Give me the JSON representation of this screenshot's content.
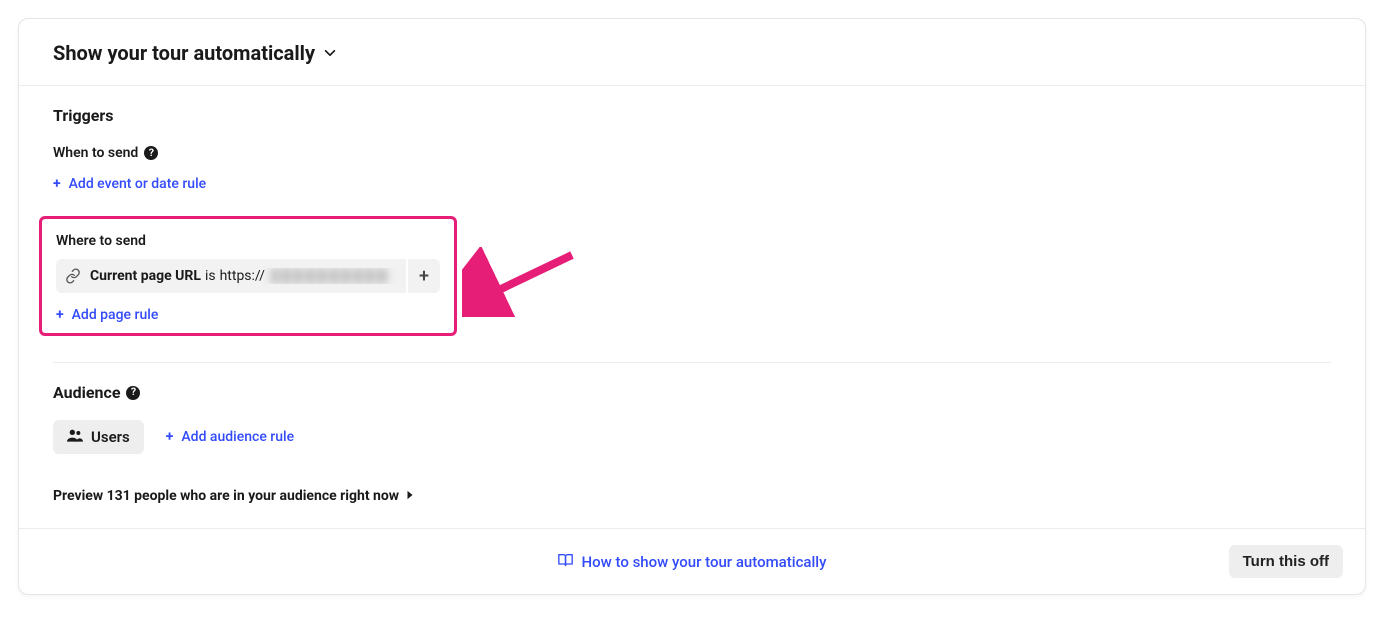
{
  "header": {
    "title": "Show your tour automatically"
  },
  "triggers": {
    "section_title": "Triggers",
    "when_to_send_label": "When to send",
    "add_event_rule": "Add event or date rule",
    "where_to_send_label": "Where to send",
    "rule": {
      "field": "Current page URL",
      "operator": "is",
      "value_prefix": "https://"
    },
    "add_page_rule": "Add page rule"
  },
  "audience": {
    "section_title": "Audience",
    "users_chip": "Users",
    "add_audience_rule": "Add audience rule",
    "preview_text": "Preview 131 people who are in your audience right now"
  },
  "footer": {
    "help_link": "How to show your tour automatically",
    "turn_off": "Turn this off"
  }
}
